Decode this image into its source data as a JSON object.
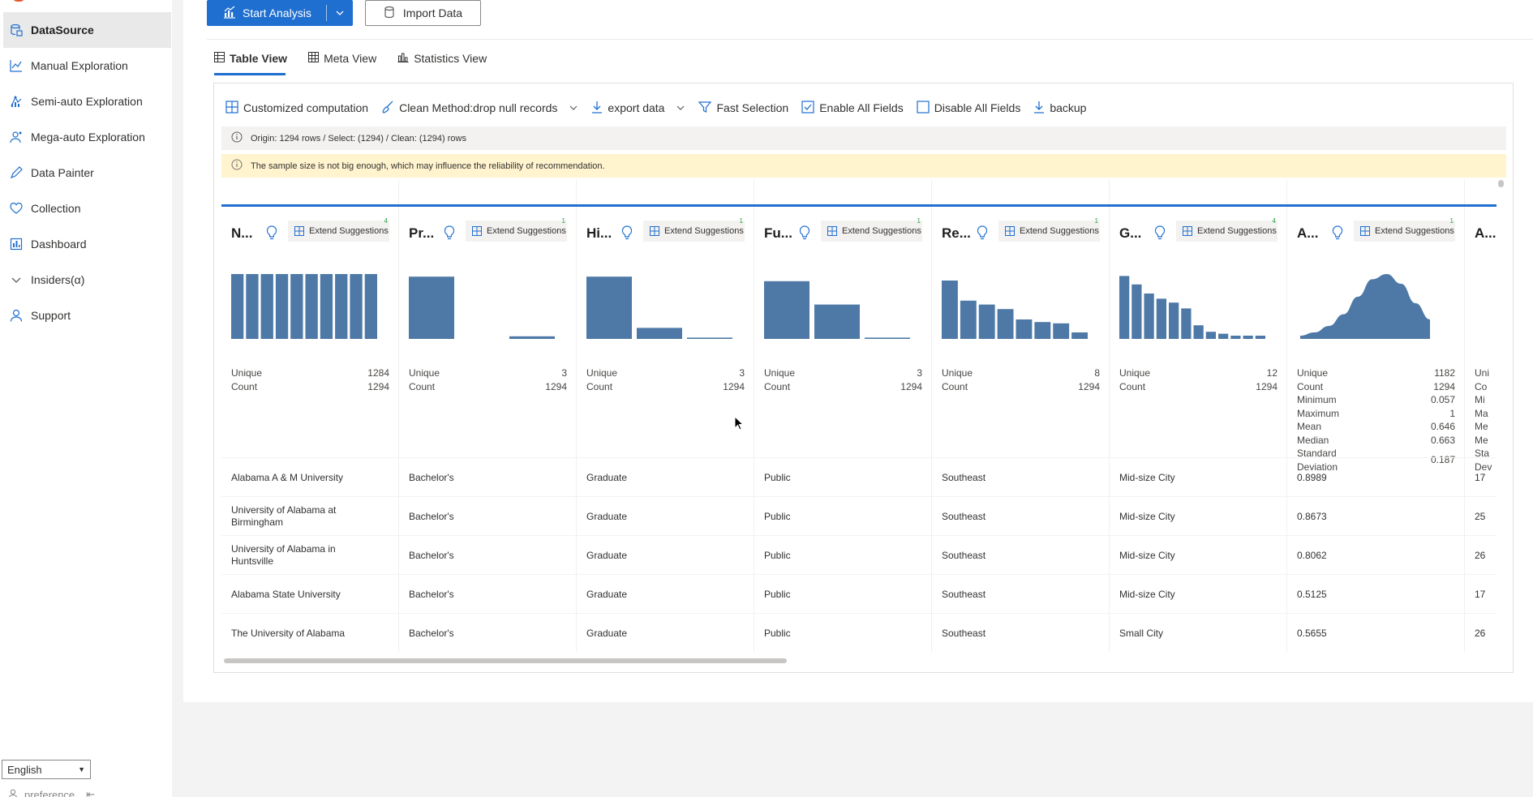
{
  "sidebar": {
    "items": [
      {
        "label": "DataSource",
        "icon": "datasource-icon",
        "active": true
      },
      {
        "label": "Manual Exploration",
        "icon": "line-chart-icon",
        "active": false
      },
      {
        "label": "Semi-auto Exploration",
        "icon": "semi-auto-icon",
        "active": false
      },
      {
        "label": "Mega-auto Exploration",
        "icon": "mega-auto-icon",
        "active": false
      },
      {
        "label": "Data Painter",
        "icon": "pencil-icon",
        "active": false
      },
      {
        "label": "Collection",
        "icon": "heart-icon",
        "active": false
      },
      {
        "label": "Dashboard",
        "icon": "dashboard-icon",
        "active": false
      },
      {
        "label": "Insiders(α)",
        "icon": "chevron-down-icon",
        "active": false
      },
      {
        "label": "Support",
        "icon": "person-icon",
        "active": false
      }
    ],
    "language": "English",
    "preference": "preference"
  },
  "header": {
    "start_analysis": "Start Analysis",
    "import_data": "Import Data"
  },
  "tabs": [
    {
      "label": "Table View",
      "active": true
    },
    {
      "label": "Meta View",
      "active": false
    },
    {
      "label": "Statistics View",
      "active": false
    }
  ],
  "toolbar": {
    "customized": "Customized computation",
    "clean_method": "Clean Method:drop null records",
    "export": "export data",
    "fast_selection": "Fast Selection",
    "enable_all": "Enable All Fields",
    "disable_all": "Disable All Fields",
    "backup": "backup"
  },
  "info_text": "Origin: 1294 rows / Select: (1294) / Clean: (1294) rows",
  "warning_text": "The sample size is not big enough, which may influence the reliability of recommendation.",
  "extend_label": "Extend Suggestions",
  "columns": [
    {
      "name": "N...",
      "badge": "4",
      "stats": [
        [
          "Unique",
          "1284"
        ],
        [
          "Count",
          "1294"
        ]
      ],
      "hist": [
        1,
        1,
        1,
        1,
        1,
        1,
        1,
        1,
        1,
        1
      ],
      "smooth": false
    },
    {
      "name": "Pr...",
      "badge": "1",
      "stats": [
        [
          "Unique",
          "3"
        ],
        [
          "Count",
          "1294"
        ]
      ],
      "hist": [
        0.96,
        0,
        0.04
      ],
      "smooth": false
    },
    {
      "name": "Hi...",
      "badge": "1",
      "stats": [
        [
          "Unique",
          "3"
        ],
        [
          "Count",
          "1294"
        ]
      ],
      "hist": [
        0.96,
        0.17,
        0.02
      ],
      "smooth": false
    },
    {
      "name": "Fu...",
      "badge": "1",
      "stats": [
        [
          "Unique",
          "3"
        ],
        [
          "Count",
          "1294"
        ]
      ],
      "hist": [
        0.89,
        0.53,
        0.02
      ],
      "smooth": false
    },
    {
      "name": "Re...",
      "badge": "1",
      "stats": [
        [
          "Unique",
          "8"
        ],
        [
          "Count",
          "1294"
        ]
      ],
      "hist": [
        0.9,
        0.59,
        0.53,
        0.46,
        0.3,
        0.26,
        0.24,
        0.1
      ],
      "smooth": false
    },
    {
      "name": "G...",
      "badge": "4",
      "stats": [
        [
          "Unique",
          "12"
        ],
        [
          "Count",
          "1294"
        ]
      ],
      "hist": [
        0.97,
        0.84,
        0.7,
        0.62,
        0.56,
        0.47,
        0.21,
        0.11,
        0.08,
        0.05,
        0.05,
        0.05
      ],
      "smooth": false
    },
    {
      "name": "A...",
      "badge": "1",
      "stats": [
        [
          "Unique",
          "1182"
        ],
        [
          "Count",
          "1294"
        ],
        [
          "Minimum",
          "0.057"
        ],
        [
          "Maximum",
          "1"
        ],
        [
          "Mean",
          "0.646"
        ],
        [
          "Median",
          "0.663"
        ],
        [
          "Standard Deviation",
          "0.187"
        ]
      ],
      "hist": [
        0.05,
        0.1,
        0.2,
        0.38,
        0.65,
        0.92,
        1.0,
        0.85,
        0.55,
        0.3
      ],
      "smooth": true
    },
    {
      "name": "A...",
      "badge": "",
      "stats": [
        [
          "Uni",
          ""
        ],
        [
          "Co",
          ""
        ],
        [
          "Mi",
          ""
        ],
        [
          "Ma",
          ""
        ],
        [
          "Me",
          ""
        ],
        [
          "Me",
          ""
        ],
        [
          "Sta",
          ""
        ],
        [
          "Dev",
          ""
        ]
      ],
      "hist": [],
      "smooth": false
    }
  ],
  "rows": [
    [
      "Alabama A & M University",
      "Bachelor's",
      "Graduate",
      "Public",
      "Southeast",
      "Mid-size City",
      "0.8989",
      "17"
    ],
    [
      "University of Alabama at Birmingham",
      "Bachelor's",
      "Graduate",
      "Public",
      "Southeast",
      "Mid-size City",
      "0.8673",
      "25"
    ],
    [
      "University of Alabama in Huntsville",
      "Bachelor's",
      "Graduate",
      "Public",
      "Southeast",
      "Mid-size City",
      "0.8062",
      "26"
    ],
    [
      "Alabama State University",
      "Bachelor's",
      "Graduate",
      "Public",
      "Southeast",
      "Mid-size City",
      "0.5125",
      "17"
    ],
    [
      "The University of Alabama",
      "Bachelor's",
      "Graduate",
      "Public",
      "Southeast",
      "Small City",
      "0.5655",
      "26"
    ]
  ],
  "colors": {
    "accent": "#1f6fd0",
    "bar": "#4e79a7",
    "warning_bg": "#fff4ce",
    "info_bg": "#f3f2f1"
  }
}
